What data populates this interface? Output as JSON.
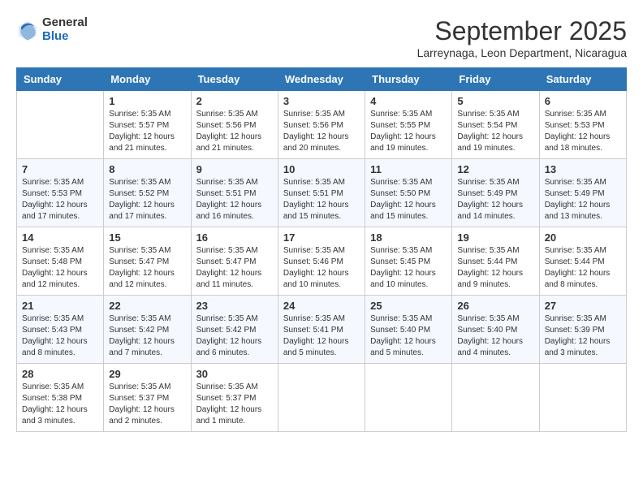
{
  "header": {
    "logo_general": "General",
    "logo_blue": "Blue",
    "month_title": "September 2025",
    "location": "Larreynaga, Leon Department, Nicaragua"
  },
  "columns": [
    "Sunday",
    "Monday",
    "Tuesday",
    "Wednesday",
    "Thursday",
    "Friday",
    "Saturday"
  ],
  "weeks": [
    [
      {
        "day": "",
        "info": ""
      },
      {
        "day": "1",
        "info": "Sunrise: 5:35 AM\nSunset: 5:57 PM\nDaylight: 12 hours\nand 21 minutes."
      },
      {
        "day": "2",
        "info": "Sunrise: 5:35 AM\nSunset: 5:56 PM\nDaylight: 12 hours\nand 21 minutes."
      },
      {
        "day": "3",
        "info": "Sunrise: 5:35 AM\nSunset: 5:56 PM\nDaylight: 12 hours\nand 20 minutes."
      },
      {
        "day": "4",
        "info": "Sunrise: 5:35 AM\nSunset: 5:55 PM\nDaylight: 12 hours\nand 19 minutes."
      },
      {
        "day": "5",
        "info": "Sunrise: 5:35 AM\nSunset: 5:54 PM\nDaylight: 12 hours\nand 19 minutes."
      },
      {
        "day": "6",
        "info": "Sunrise: 5:35 AM\nSunset: 5:53 PM\nDaylight: 12 hours\nand 18 minutes."
      }
    ],
    [
      {
        "day": "7",
        "info": "Sunrise: 5:35 AM\nSunset: 5:53 PM\nDaylight: 12 hours\nand 17 minutes."
      },
      {
        "day": "8",
        "info": "Sunrise: 5:35 AM\nSunset: 5:52 PM\nDaylight: 12 hours\nand 17 minutes."
      },
      {
        "day": "9",
        "info": "Sunrise: 5:35 AM\nSunset: 5:51 PM\nDaylight: 12 hours\nand 16 minutes."
      },
      {
        "day": "10",
        "info": "Sunrise: 5:35 AM\nSunset: 5:51 PM\nDaylight: 12 hours\nand 15 minutes."
      },
      {
        "day": "11",
        "info": "Sunrise: 5:35 AM\nSunset: 5:50 PM\nDaylight: 12 hours\nand 15 minutes."
      },
      {
        "day": "12",
        "info": "Sunrise: 5:35 AM\nSunset: 5:49 PM\nDaylight: 12 hours\nand 14 minutes."
      },
      {
        "day": "13",
        "info": "Sunrise: 5:35 AM\nSunset: 5:49 PM\nDaylight: 12 hours\nand 13 minutes."
      }
    ],
    [
      {
        "day": "14",
        "info": "Sunrise: 5:35 AM\nSunset: 5:48 PM\nDaylight: 12 hours\nand 12 minutes."
      },
      {
        "day": "15",
        "info": "Sunrise: 5:35 AM\nSunset: 5:47 PM\nDaylight: 12 hours\nand 12 minutes."
      },
      {
        "day": "16",
        "info": "Sunrise: 5:35 AM\nSunset: 5:47 PM\nDaylight: 12 hours\nand 11 minutes."
      },
      {
        "day": "17",
        "info": "Sunrise: 5:35 AM\nSunset: 5:46 PM\nDaylight: 12 hours\nand 10 minutes."
      },
      {
        "day": "18",
        "info": "Sunrise: 5:35 AM\nSunset: 5:45 PM\nDaylight: 12 hours\nand 10 minutes."
      },
      {
        "day": "19",
        "info": "Sunrise: 5:35 AM\nSunset: 5:44 PM\nDaylight: 12 hours\nand 9 minutes."
      },
      {
        "day": "20",
        "info": "Sunrise: 5:35 AM\nSunset: 5:44 PM\nDaylight: 12 hours\nand 8 minutes."
      }
    ],
    [
      {
        "day": "21",
        "info": "Sunrise: 5:35 AM\nSunset: 5:43 PM\nDaylight: 12 hours\nand 8 minutes."
      },
      {
        "day": "22",
        "info": "Sunrise: 5:35 AM\nSunset: 5:42 PM\nDaylight: 12 hours\nand 7 minutes."
      },
      {
        "day": "23",
        "info": "Sunrise: 5:35 AM\nSunset: 5:42 PM\nDaylight: 12 hours\nand 6 minutes."
      },
      {
        "day": "24",
        "info": "Sunrise: 5:35 AM\nSunset: 5:41 PM\nDaylight: 12 hours\nand 5 minutes."
      },
      {
        "day": "25",
        "info": "Sunrise: 5:35 AM\nSunset: 5:40 PM\nDaylight: 12 hours\nand 5 minutes."
      },
      {
        "day": "26",
        "info": "Sunrise: 5:35 AM\nSunset: 5:40 PM\nDaylight: 12 hours\nand 4 minutes."
      },
      {
        "day": "27",
        "info": "Sunrise: 5:35 AM\nSunset: 5:39 PM\nDaylight: 12 hours\nand 3 minutes."
      }
    ],
    [
      {
        "day": "28",
        "info": "Sunrise: 5:35 AM\nSunset: 5:38 PM\nDaylight: 12 hours\nand 3 minutes."
      },
      {
        "day": "29",
        "info": "Sunrise: 5:35 AM\nSunset: 5:37 PM\nDaylight: 12 hours\nand 2 minutes."
      },
      {
        "day": "30",
        "info": "Sunrise: 5:35 AM\nSunset: 5:37 PM\nDaylight: 12 hours\nand 1 minute."
      },
      {
        "day": "",
        "info": ""
      },
      {
        "day": "",
        "info": ""
      },
      {
        "day": "",
        "info": ""
      },
      {
        "day": "",
        "info": ""
      }
    ]
  ]
}
